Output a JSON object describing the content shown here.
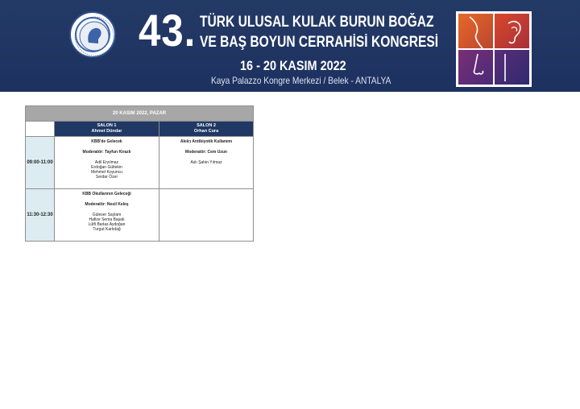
{
  "header": {
    "number": "43.",
    "title_line1": "TÜRK ULUSAL KULAK BURUN BOĞAZ",
    "title_line2": "VE BAŞ BOYUN CERRAHİSİ KONGRESİ",
    "dates": "16 - 20 KASIM 2022",
    "venue": "Kaya Palazzo Kongre Merkezi / Belek - ANTALYA",
    "colors": {
      "background": "#1f3560",
      "logo_cell_1": "#d9582b",
      "logo_cell_2": "#c0392b",
      "logo_cell_3": "#6a2c7d",
      "logo_cell_4": "#3b2a7a"
    }
  },
  "schedule": {
    "day": "20 KASIM 2022, PAZAR",
    "salons": [
      {
        "name": "SALON 1",
        "person": "Ahmet Dündar"
      },
      {
        "name": "SALON 2",
        "person": "Orhan Cura"
      }
    ],
    "rows": [
      {
        "time": "09:00-11:00",
        "sessions": [
          {
            "title": "KBB'de Gelecek",
            "moderator": "Moderatör: Tayfun Kirazlı",
            "speakers": [
              "Adil Eryılmaz",
              "Erdoğan Gültekin",
              "Mehmet Koyuncu",
              "Serdar Özer"
            ]
          },
          {
            "title": "Akılcı Antibiyotik Kullanımı",
            "moderator": "Moderatör: Cem Uzun",
            "speakers": [
              "Aslı Şahin Yılmaz"
            ]
          }
        ]
      },
      {
        "time": "11:30-12:30",
        "sessions": [
          {
            "title": "KBB Okullarının Geleceği",
            "moderator": "Moderatör: Nesil Keleş",
            "speakers": [
              "Güleser Saylam",
              "Hafize Sema Başak",
              "Lütfi Barlas Aydoğan",
              "Turgut Karlıdağ"
            ]
          },
          {
            "title": "",
            "moderator": "",
            "speakers": []
          }
        ]
      }
    ]
  }
}
